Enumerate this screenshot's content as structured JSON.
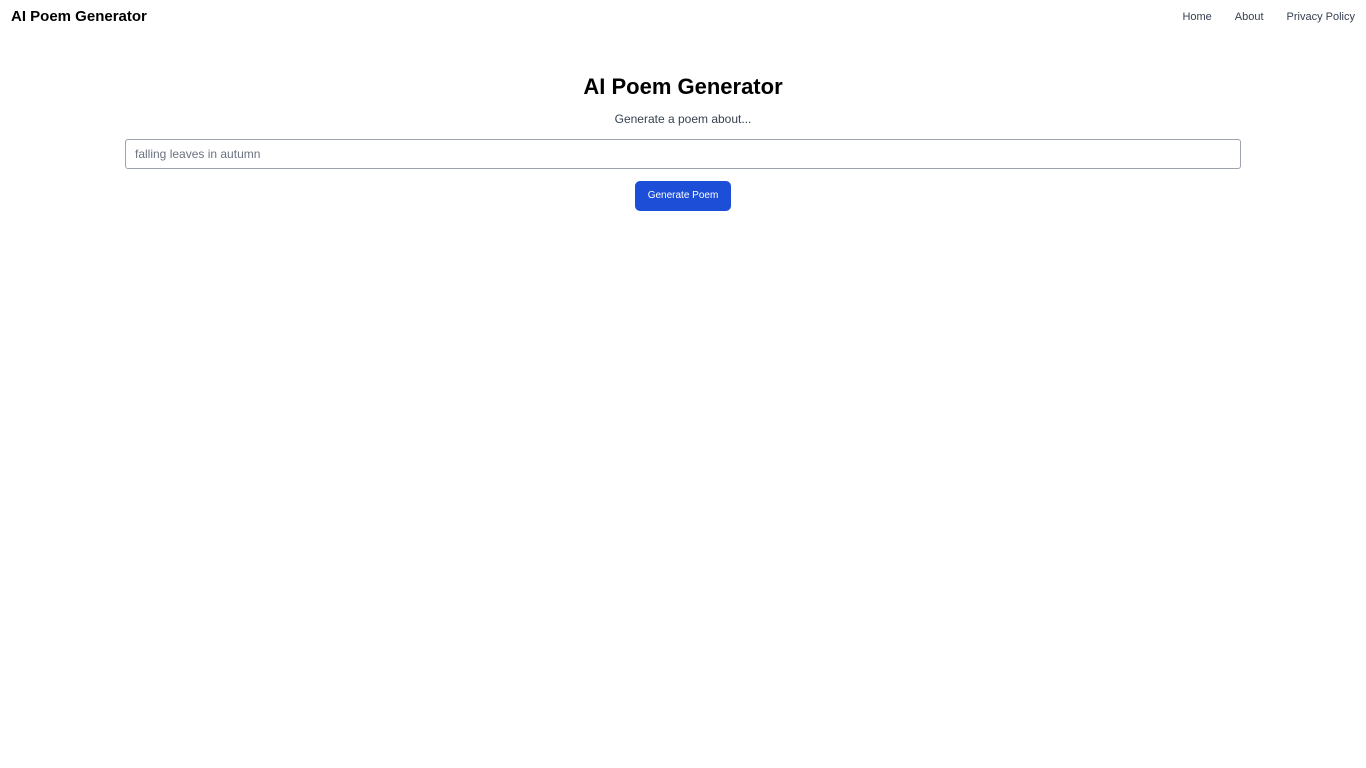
{
  "header": {
    "brand": "AI Poem Generator",
    "nav": [
      {
        "label": "Home"
      },
      {
        "label": "About"
      },
      {
        "label": "Privacy Policy"
      }
    ]
  },
  "main": {
    "title": "AI Poem Generator",
    "subtitle": "Generate a poem about...",
    "topic_input": {
      "value": "",
      "placeholder": "falling leaves in autumn"
    },
    "generate_button_label": "Generate Poem"
  },
  "colors": {
    "accent": "#1d4ed8",
    "background": "#ffffff",
    "text": "#000000",
    "muted_text": "#374151"
  }
}
